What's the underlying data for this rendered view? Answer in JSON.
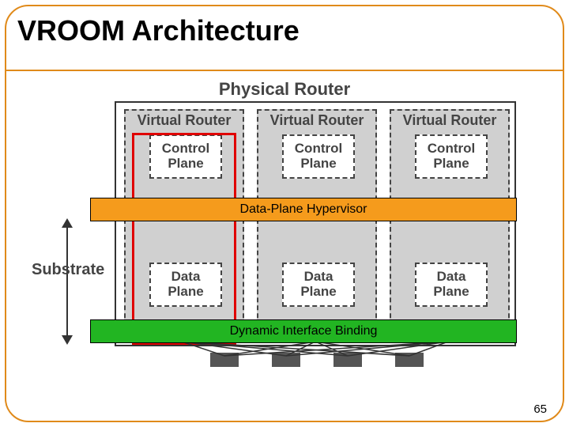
{
  "title": "VROOM Architecture",
  "page_number": "65",
  "diagram": {
    "physical_router_label": "Physical Router",
    "substrate_label": "Substrate",
    "virtual_routers": [
      {
        "label": "Virtual Router",
        "control": "Control\nPlane",
        "data": "Data\nPlane",
        "highlighted": true
      },
      {
        "label": "Virtual Router",
        "control": "Control\nPlane",
        "data": "Data\nPlane",
        "highlighted": false
      },
      {
        "label": "Virtual Router",
        "control": "Control\nPlane",
        "data": "Data\nPlane",
        "highlighted": false
      }
    ],
    "hypervisor_label": "Data-Plane Hypervisor",
    "dynamic_binding_label": "Dynamic Interface Binding",
    "nic_count": 4,
    "colors": {
      "frame": "#e08a1a",
      "hypervisor": "#f59b1c",
      "dynamic_binding": "#22b522",
      "highlight": "#e00000",
      "vr_bg": "#d0d0d0"
    }
  }
}
